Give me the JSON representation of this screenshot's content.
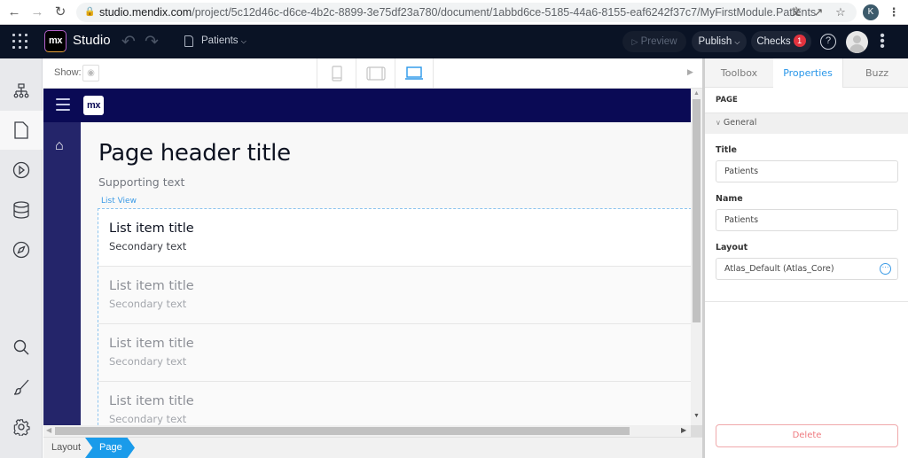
{
  "browser": {
    "url_host": "studio.mendix.com",
    "url_path": "/project/5c12d46c-d6ce-4b2c-8899-3e75df23a780/document/1abbd6ce-5185-44a6-8155-eaf6242f37c7/MyFirstModule.Patients",
    "profile_initial": "K",
    "icons": [
      "back-icon",
      "forward-icon",
      "reload-icon",
      "lock-icon",
      "translate-icon",
      "share-icon",
      "bookmark-star-icon",
      "profile-avatar",
      "menu-dots-icon"
    ]
  },
  "header": {
    "logo_text": "mx",
    "app_name": "Studio",
    "document_name": "Patients",
    "preview_label": "Preview",
    "publish_label": "Publish",
    "checks_label": "Checks",
    "checks_count": "1",
    "help_glyph": "?"
  },
  "leftnav": {
    "items": [
      {
        "name": "navigation",
        "icon": "sitemap-icon"
      },
      {
        "name": "pages",
        "icon": "page-icon",
        "active": true
      },
      {
        "name": "microflows",
        "icon": "play-circle-icon"
      },
      {
        "name": "domain-model",
        "icon": "database-icon"
      },
      {
        "name": "explorer",
        "icon": "compass-icon"
      },
      {
        "name": "search",
        "icon": "search-icon"
      },
      {
        "name": "theme",
        "icon": "brush-icon"
      },
      {
        "name": "settings",
        "icon": "gear-icon"
      }
    ]
  },
  "canvas_toolbar": {
    "show_label": "Show:",
    "devices": [
      {
        "name": "phone",
        "active": false
      },
      {
        "name": "tablet",
        "active": false
      },
      {
        "name": "desktop",
        "active": true
      }
    ]
  },
  "canvas": {
    "logo_text": "mx",
    "page_title": "Page header title",
    "supporting_text": "Supporting text",
    "list_view_label": "List View",
    "list_items": [
      {
        "title": "List item title",
        "secondary": "Secondary text"
      },
      {
        "title": "List item title",
        "secondary": "Secondary text"
      },
      {
        "title": "List item title",
        "secondary": "Secondary text"
      },
      {
        "title": "List item title",
        "secondary": "Secondary text"
      }
    ]
  },
  "breadcrumb": {
    "items": [
      "Layout",
      "Page"
    ],
    "active": "Page"
  },
  "right_panel": {
    "tabs": [
      "Toolbox",
      "Properties",
      "Buzz"
    ],
    "active_tab": "Properties",
    "section": "PAGE",
    "group": "General",
    "fields": {
      "title_label": "Title",
      "title_value": "Patients",
      "name_label": "Name",
      "name_value": "Patients",
      "layout_label": "Layout",
      "layout_value": "Atlas_Default (Atlas_Core)"
    },
    "delete_label": "Delete"
  },
  "colors": {
    "header_bg": "#0a1325",
    "accent": "#2896e9",
    "app_topbar": "#0a0a55",
    "app_sidebar": "#24256a",
    "badge": "#e2333e",
    "delete": "#ef7a7f"
  }
}
